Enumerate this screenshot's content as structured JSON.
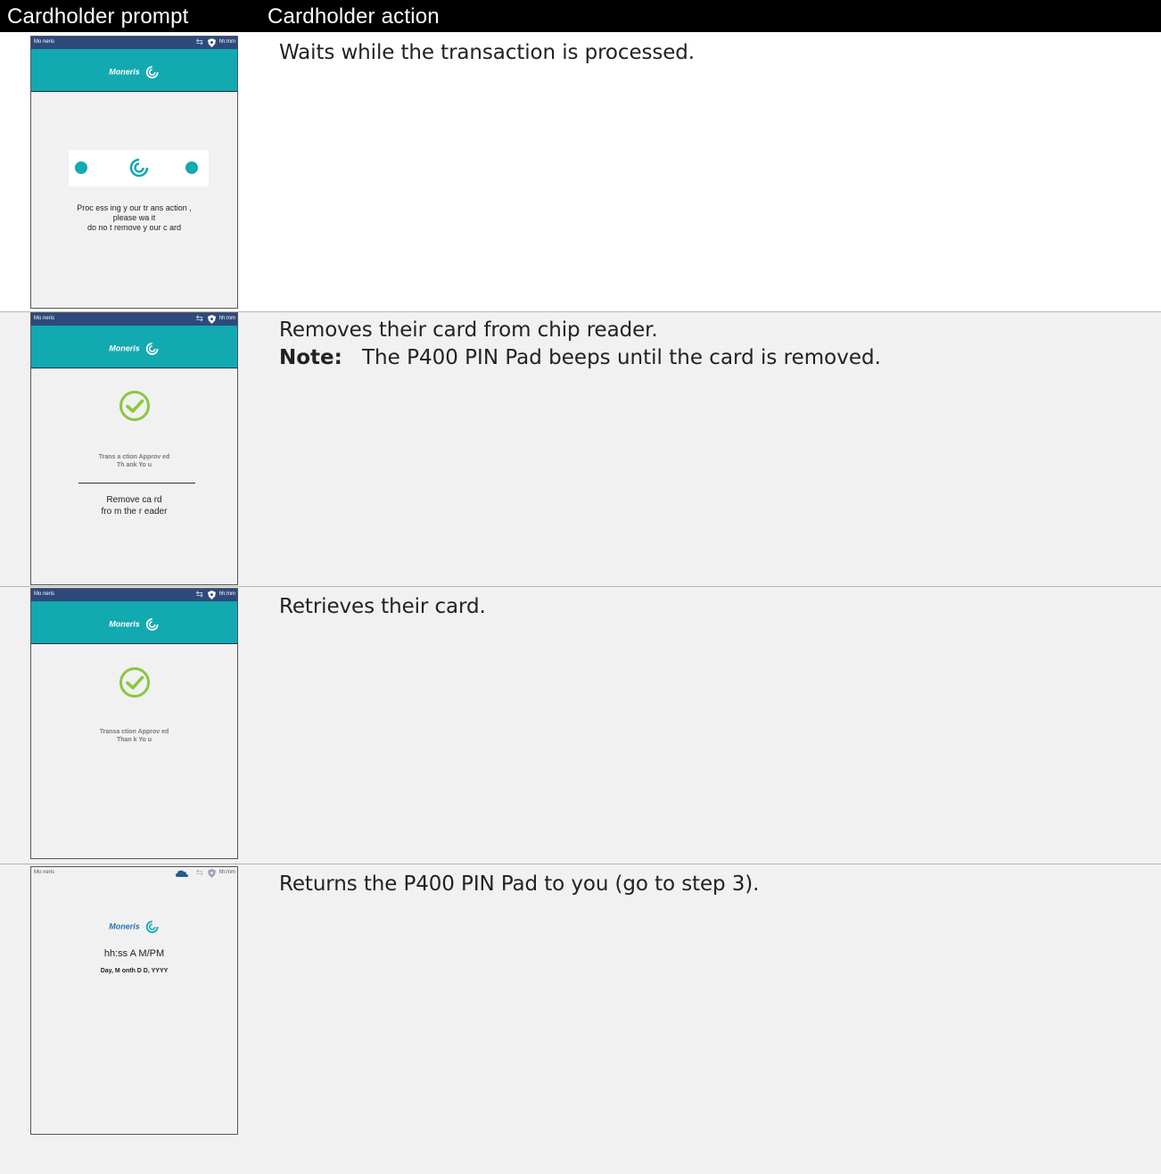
{
  "header": {
    "prompt_label": "Cardholder prompt",
    "action_label": "Cardholder action"
  },
  "rows": [
    {
      "action": "Waits while the transaction is processed.",
      "device": {
        "status_left": "Mo neris",
        "status_time": "hh:mm",
        "brand": "Moneris",
        "message_lines": [
          "Proc ess ing y our tr ans action ,",
          "please wa it",
          "do no t remove y our c ard"
        ]
      }
    },
    {
      "action": "Removes their card from chip reader.",
      "note_label": "Note:",
      "note_text": "The P400 PIN Pad beeps until the card is removed.",
      "device": {
        "status_left": "Mo neris",
        "status_time": "hh:mm",
        "brand": "Moneris",
        "approved_lines": [
          "Trans a ction Approv ed",
          "Th ank Yo u"
        ],
        "remove_lines": [
          "Remove ca rd",
          "fro m the r eader"
        ]
      }
    },
    {
      "action": "Retrieves their card.",
      "device": {
        "status_left": "Mo neris",
        "status_time": "hh:mm",
        "brand": "Moneris",
        "approved_lines": [
          "Transa ction Approv ed",
          "Than k Yo u"
        ]
      }
    },
    {
      "action": "Returns the P400 PIN Pad to you (go to step 3).",
      "device": {
        "status_left": "Mo neris",
        "status_time": "hh:mm",
        "brand": "Moneris",
        "clock": "hh:ss A M/PM",
        "date": "Day, M onth D D, YYYY"
      }
    }
  ],
  "colors": {
    "header_bg": "#000000",
    "row_bg": "#f1f1f1",
    "teal": "#12a9b1",
    "status_blue": "#2d4a7c",
    "check_green": "#8cc63f"
  },
  "icons": [
    "transfer-arrows-icon",
    "shield-icon",
    "cloud-icon",
    "moneris-swirl-icon",
    "checkmark-circle-icon",
    "dot-icon"
  ]
}
